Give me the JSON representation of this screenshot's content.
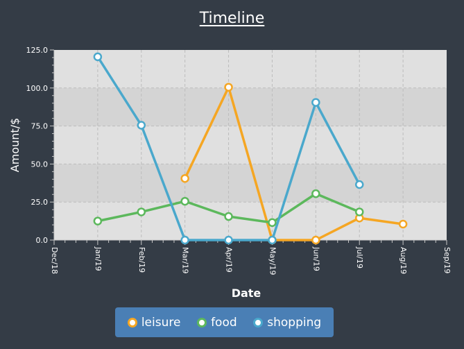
{
  "chart_data": {
    "type": "line",
    "title": "Timeline",
    "xlabel": "Date",
    "ylabel": "Amount/$",
    "x_ticks": [
      "Dec/18",
      "Jan/19",
      "Feb/19",
      "Mar/19",
      "Apr/19",
      "May/19",
      "Jun/19",
      "Jul/19",
      "Aug/19",
      "Sep/19"
    ],
    "y_ticks": [
      "0.0",
      "25.0",
      "50.0",
      "75.0",
      "100.0",
      "125.0"
    ],
    "ylim": [
      0,
      125
    ],
    "grid": true,
    "legend_position": "bottom",
    "series": [
      {
        "name": "leisure",
        "color": "#f5a623",
        "points": [
          [
            "Mar/19",
            40.5
          ],
          [
            "Apr/19",
            100.5
          ],
          [
            "May/19",
            0
          ],
          [
            "Jun/19",
            0
          ],
          [
            "Jul/19",
            14.5
          ],
          [
            "Aug/19",
            10.5
          ]
        ]
      },
      {
        "name": "food",
        "color": "#5cb85c",
        "points": [
          [
            "Jan/19",
            12.5
          ],
          [
            "Feb/19",
            18.5
          ],
          [
            "Mar/19",
            25.5
          ],
          [
            "Apr/19",
            15.5
          ],
          [
            "May/19",
            11.5
          ],
          [
            "Jun/19",
            30.5
          ],
          [
            "Jul/19",
            18.5
          ]
        ]
      },
      {
        "name": "shopping",
        "color": "#4aa8cc",
        "points": [
          [
            "Jan/19",
            120.5
          ],
          [
            "Feb/19",
            75.5
          ],
          [
            "Mar/19",
            0
          ],
          [
            "Apr/19",
            0
          ],
          [
            "May/19",
            0
          ],
          [
            "Jun/19",
            90.5
          ],
          [
            "Jul/19",
            36.5
          ]
        ]
      }
    ]
  }
}
